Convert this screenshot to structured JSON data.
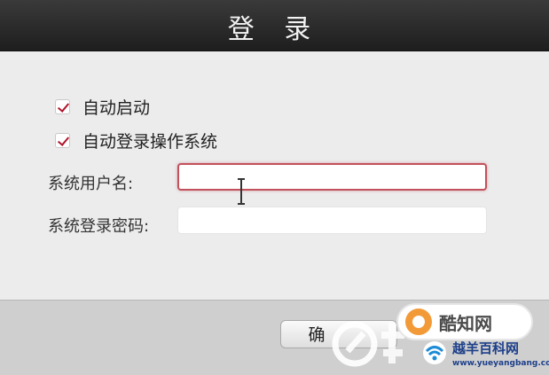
{
  "dialog": {
    "title": "登 录"
  },
  "options": {
    "auto_start": {
      "label": "自动启动",
      "checked": true
    },
    "auto_login": {
      "label": "自动登录操作系统",
      "checked": true
    }
  },
  "form": {
    "username": {
      "label": "系统用户名:",
      "value": "",
      "focused": true
    },
    "password": {
      "label": "系统登录密码:",
      "value": ""
    }
  },
  "footer": {
    "confirm_button_label": "确"
  },
  "watermarks": {
    "badge_text": "酷知网",
    "site_name": "越羊百科网",
    "site_url": "www.yueyangbang.com"
  },
  "colors": {
    "focus_border": "#c2515b",
    "check_mark": "#b0142c",
    "title_bar": "#2b2b2b"
  },
  "icons": {
    "checkbox_mark": "checkmark-icon",
    "text_cursor": "ibeam-cursor-icon"
  }
}
